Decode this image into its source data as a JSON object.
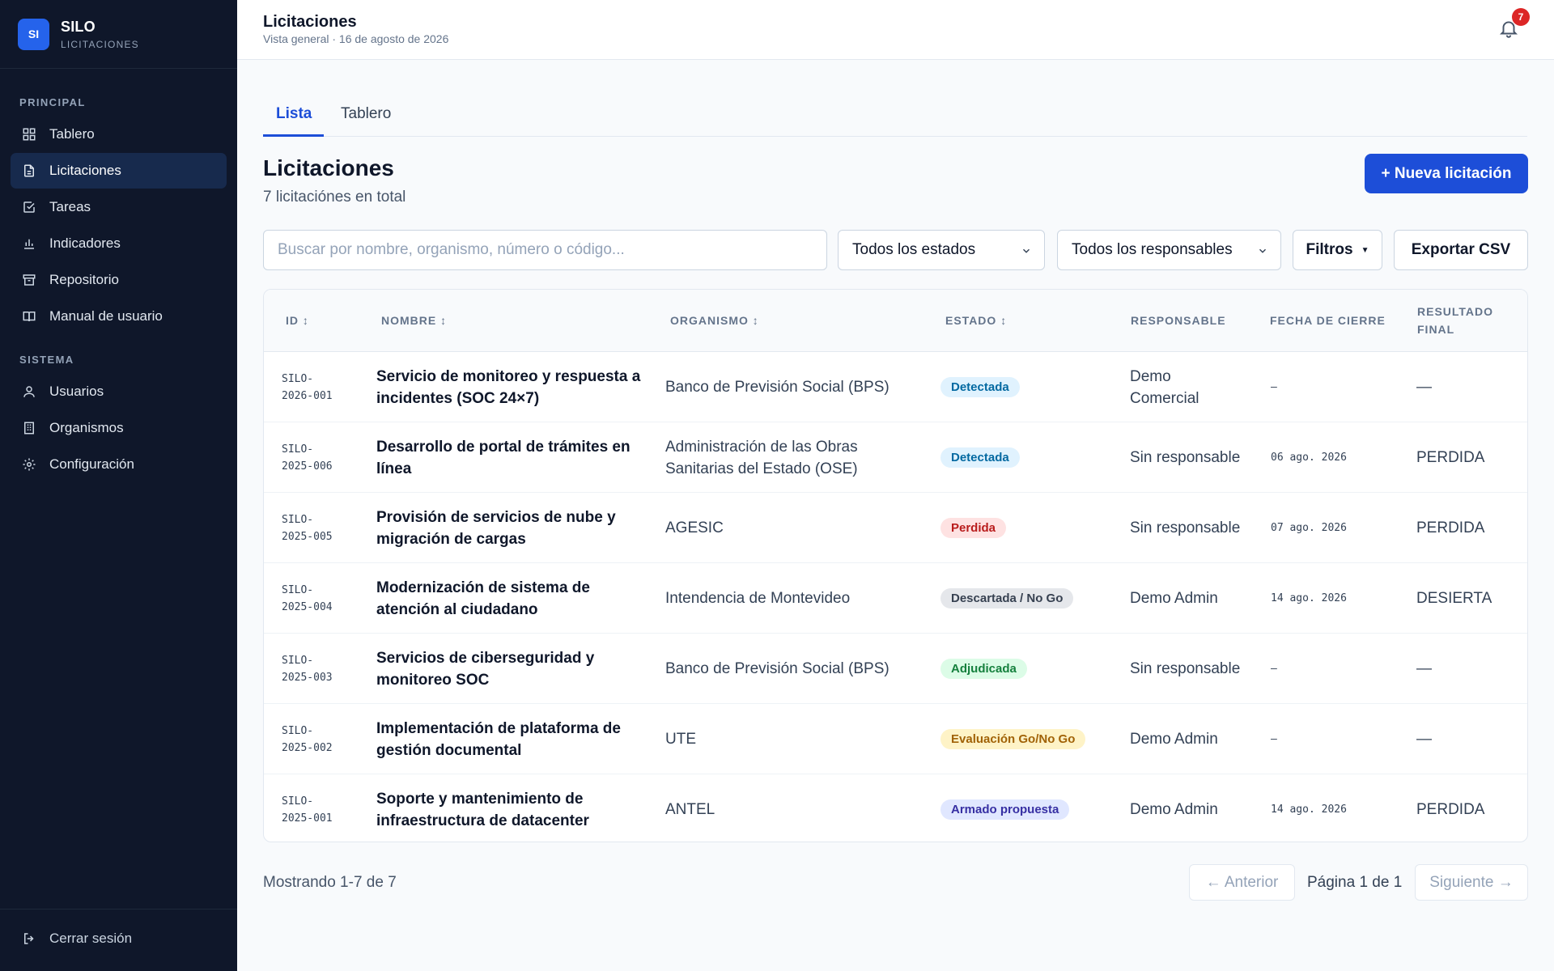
{
  "brand": {
    "logo": "SI",
    "name": "SILO",
    "subtitle": "LICITACIONES"
  },
  "sidebar": {
    "section_main": "PRINCIPAL",
    "section_system": "SISTEMA",
    "items": [
      {
        "label": "Tablero",
        "icon": "grid-icon"
      },
      {
        "label": "Licitaciones",
        "icon": "document-icon",
        "active": true
      },
      {
        "label": "Tareas",
        "icon": "checkbox-icon"
      },
      {
        "label": "Indicadores",
        "icon": "bar-chart-icon"
      },
      {
        "label": "Repositorio",
        "icon": "archive-icon"
      },
      {
        "label": "Manual de usuario",
        "icon": "book-icon"
      },
      {
        "label": "Usuarios",
        "icon": "users-icon"
      },
      {
        "label": "Organismos",
        "icon": "building-icon"
      },
      {
        "label": "Configuración",
        "icon": "gear-icon"
      }
    ],
    "logout": "Cerrar sesión"
  },
  "header": {
    "title": "Licitaciones",
    "subtitle": "Vista general · 16 de agosto de 2026",
    "notifications": "7"
  },
  "tabs": [
    "Lista",
    "Tablero"
  ],
  "main": {
    "title": "Licitaciones",
    "subtitle": "7 licitaciónes en total",
    "new_button": "+ Nueva licitación"
  },
  "filters": {
    "search_placeholder": "Buscar por nombre, organismo, número o código...",
    "state_select": "Todos los estados",
    "owner_select": "Todos los responsables",
    "filters_button": "Filtros",
    "export_button": "Exportar CSV"
  },
  "table": {
    "columns": [
      "ID ↕",
      "NOMBRE ↕",
      "ORGANISMO ↕",
      "ESTADO ↕",
      "RESPONSABLE",
      "FECHA DE CIERRE",
      "RESULTADO FINAL"
    ],
    "rows": [
      {
        "id_a": "SILO-",
        "id_b": "2026-001",
        "name": "Servicio de monitoreo y respuesta a incidentes (SOC 24×7)",
        "org": "Banco de Previsión Social (BPS)",
        "state": "Detectada",
        "state_bg": "#e0f2fe",
        "state_fg": "#0369a1",
        "owner": "Demo Comercial",
        "date": "–",
        "result": "—"
      },
      {
        "id_a": "SILO-",
        "id_b": "2025-006",
        "name": "Desarrollo de portal de trámites en línea",
        "org": "Administración de las Obras Sanitarias del Estado (OSE)",
        "state": "Detectada",
        "state_bg": "#e0f2fe",
        "state_fg": "#0369a1",
        "owner": "Sin responsable",
        "date": "06 ago. 2026",
        "result": "PERDIDA"
      },
      {
        "id_a": "SILO-",
        "id_b": "2025-005",
        "name": "Provisión de servicios de nube y migración de cargas",
        "org": "AGESIC",
        "state": "Perdida",
        "state_bg": "#fee2e2",
        "state_fg": "#b91c1c",
        "owner": "Sin responsable",
        "date": "07 ago. 2026",
        "result": "PERDIDA"
      },
      {
        "id_a": "SILO-",
        "id_b": "2025-004",
        "name": "Modernización de sistema de atención al ciudadano",
        "org": "Intendencia de Montevideo",
        "state": "Descartada / No Go",
        "state_bg": "#e5e7eb",
        "state_fg": "#374151",
        "owner": "Demo Admin",
        "date": "14 ago. 2026",
        "result": "DESIERTA"
      },
      {
        "id_a": "SILO-",
        "id_b": "2025-003",
        "name": "Servicios de ciberseguridad y monitoreo SOC",
        "org": "Banco de Previsión Social (BPS)",
        "state": "Adjudicada",
        "state_bg": "#dcfce7",
        "state_fg": "#15803d",
        "owner": "Sin responsable",
        "date": "–",
        "result": "—"
      },
      {
        "id_a": "SILO-",
        "id_b": "2025-002",
        "name": "Implementación de plataforma de gestión documental",
        "org": "UTE",
        "state": "Evaluación Go/No Go",
        "state_bg": "#fef3c7",
        "state_fg": "#a16207",
        "owner": "Demo Admin",
        "date": "–",
        "result": "—"
      },
      {
        "id_a": "SILO-",
        "id_b": "2025-001",
        "name": "Soporte y mantenimiento de infraestructura de datacenter",
        "org": "ANTEL",
        "state": "Armado propuesta",
        "state_bg": "#e0e7ff",
        "state_fg": "#3730a3",
        "owner": "Demo Admin",
        "date": "14 ago. 2026",
        "result": "PERDIDA"
      }
    ]
  },
  "pagination": {
    "showing": "Mostrando 1-7 de 7",
    "prev": "← Anterior",
    "page": "Página 1 de 1",
    "next": "Siguiente →"
  },
  "colors": {
    "accent": "#1d4ed8",
    "sidebar_bg": "#0f172a",
    "sidebar_active": "#172a4d",
    "notification": "#dc2626"
  }
}
